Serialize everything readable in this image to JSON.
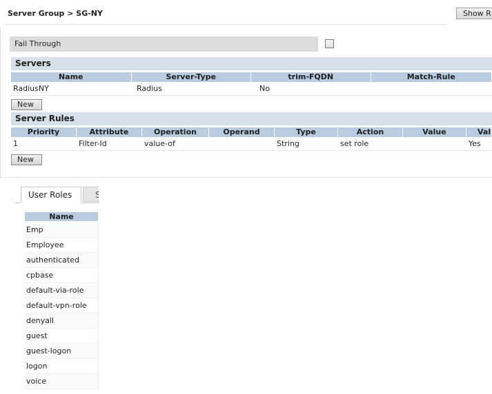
{
  "header": {
    "breadcrumb": "Server Group > SG-NY",
    "show_button": "Show R"
  },
  "fail_through": {
    "label": "Fail Through",
    "checked": false
  },
  "servers": {
    "title": "Servers",
    "columns": [
      "Name",
      "Server-Type",
      "trim-FQDN",
      "Match-Rule"
    ],
    "rows": [
      [
        "RadiusNY",
        "Radius",
        "No",
        ""
      ]
    ],
    "new_button": "New"
  },
  "server_rules": {
    "title": "Server Rules",
    "columns": [
      "Priority",
      "Attribute",
      "Operation",
      "Operand",
      "Type",
      "Action",
      "Value",
      "Val"
    ],
    "rows": [
      [
        "1",
        "Filter-Id",
        "value-of",
        "",
        "String",
        "set role",
        "",
        "Yes"
      ]
    ],
    "new_button": "New"
  },
  "tabs": {
    "active": "User Roles",
    "next": "S"
  },
  "user_roles": {
    "column": "Name",
    "items": [
      "Emp",
      "Employee",
      "authenticated",
      "cpbase",
      "default-via-role",
      "default-vpn-role",
      "denyall",
      "guest",
      "guest-logon",
      "logon",
      "voice"
    ]
  }
}
